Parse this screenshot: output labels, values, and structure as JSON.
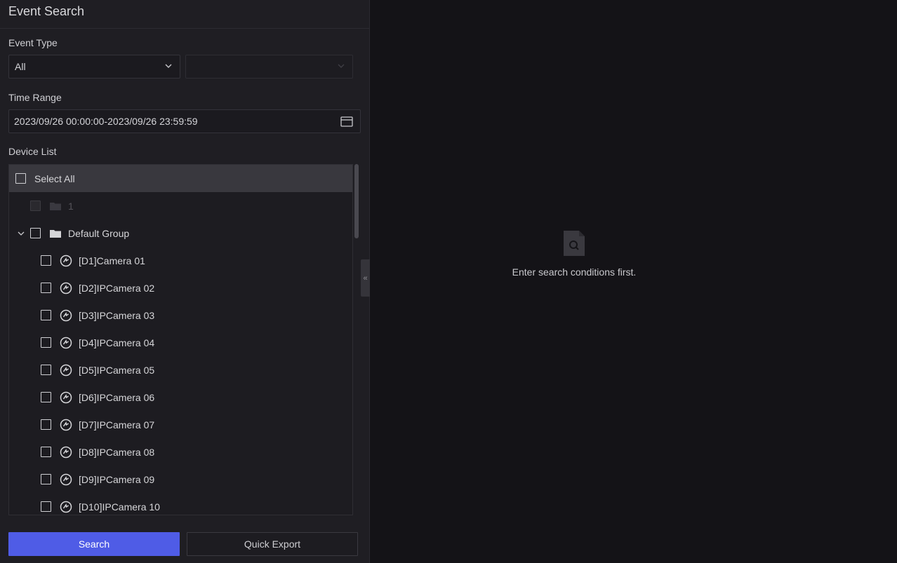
{
  "panel": {
    "title": "Event Search"
  },
  "event_type": {
    "label": "Event Type",
    "primary_value": "All",
    "secondary_value": ""
  },
  "time_range": {
    "label": "Time Range",
    "value": "2023/09/26 00:00:00-2023/09/26 23:59:59"
  },
  "device_list": {
    "label": "Device List",
    "select_all": "Select All",
    "ungrouped_item": "1",
    "group_name": "Default Group",
    "cameras": [
      "[D1]Camera 01",
      "[D2]IPCamera 02",
      "[D3]IPCamera 03",
      "[D4]IPCamera 04",
      "[D5]IPCamera 05",
      "[D6]IPCamera 06",
      "[D7]IPCamera 07",
      "[D8]IPCamera 08",
      "[D9]IPCamera 09",
      "[D10]IPCamera 10"
    ]
  },
  "collapse_handle": "«",
  "buttons": {
    "search": "Search",
    "quick_export": "Quick Export"
  },
  "empty_state": {
    "message": "Enter search conditions first.",
    "icon": "document-search-icon"
  },
  "colors": {
    "accent": "#4f5ce6",
    "panel_bg": "#1f1e23",
    "page_bg": "#141317"
  }
}
